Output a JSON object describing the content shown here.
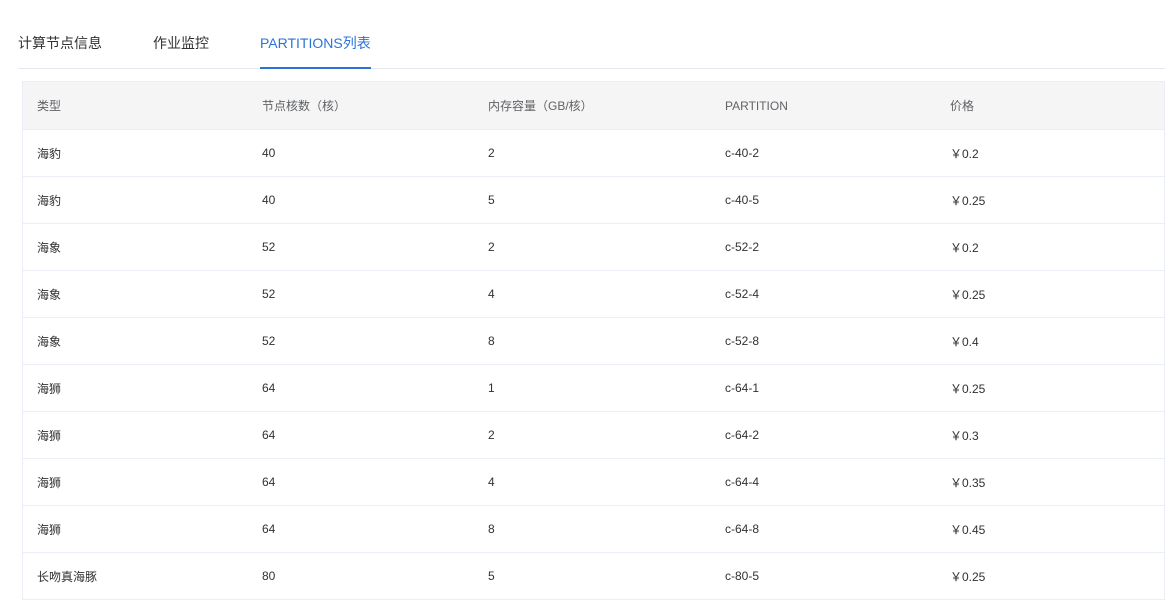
{
  "tabs": [
    {
      "label": "计算节点信息",
      "active": false
    },
    {
      "label": "作业监控",
      "active": false
    },
    {
      "label": "PARTITIONS列表",
      "active": true
    }
  ],
  "colors": {
    "accent": "#2a74d8",
    "header_bg": "#f5f5f5",
    "border": "#ebeef5"
  },
  "table": {
    "columns": [
      "类型",
      "节点核数（核）",
      "内存容量（GB/核）",
      "PARTITION",
      "价格"
    ],
    "rows": [
      [
        "海豹",
        "40",
        "2",
        "c-40-2",
        "￥0.2"
      ],
      [
        "海豹",
        "40",
        "5",
        "c-40-5",
        "￥0.25"
      ],
      [
        "海象",
        "52",
        "2",
        "c-52-2",
        "￥0.2"
      ],
      [
        "海象",
        "52",
        "4",
        "c-52-4",
        "￥0.25"
      ],
      [
        "海象",
        "52",
        "8",
        "c-52-8",
        "￥0.4"
      ],
      [
        "海狮",
        "64",
        "1",
        "c-64-1",
        "￥0.25"
      ],
      [
        "海狮",
        "64",
        "2",
        "c-64-2",
        "￥0.3"
      ],
      [
        "海狮",
        "64",
        "4",
        "c-64-4",
        "￥0.35"
      ],
      [
        "海狮",
        "64",
        "8",
        "c-64-8",
        "￥0.45"
      ],
      [
        "长吻真海豚",
        "80",
        "5",
        "c-80-5",
        "￥0.25"
      ]
    ]
  }
}
